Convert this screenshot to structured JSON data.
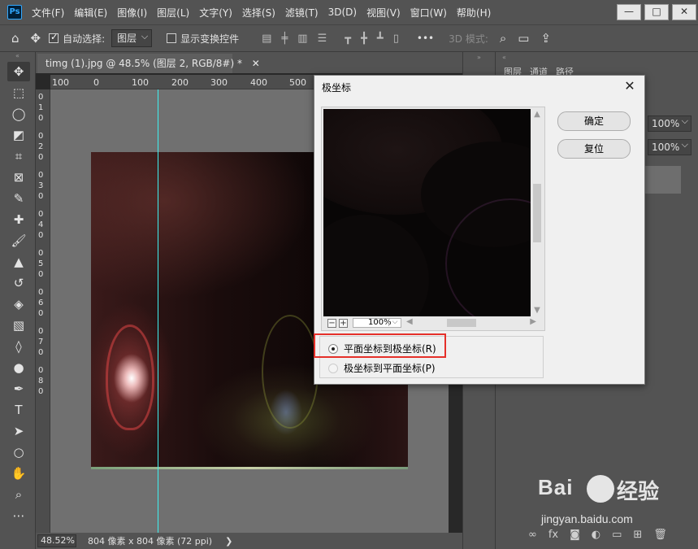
{
  "app": {
    "logo": "Ps",
    "menu": [
      "文件(F)",
      "编辑(E)",
      "图像(I)",
      "图层(L)",
      "文字(Y)",
      "选择(S)",
      "滤镜(T)",
      "3D(D)",
      "视图(V)",
      "窗口(W)",
      "帮助(H)"
    ],
    "window_controls": [
      "—",
      "□",
      "✕"
    ]
  },
  "options_bar": {
    "auto_select_label": "自动选择:",
    "auto_select_value": "图层",
    "show_transform_label": "显示变换控件",
    "more": "•••",
    "mode_3d": "3D 模式:"
  },
  "document": {
    "tab_title": "timg (1).jpg @ 48.5% (图层 2, RGB/8#) *",
    "tab_close": "✕",
    "ruler_top": [
      "100",
      "0",
      "100",
      "200",
      "300",
      "400",
      "500"
    ],
    "ruler_left": [
      "0",
      "1",
      "0",
      "0",
      "2",
      "0",
      "0",
      "3",
      "0",
      "0",
      "4",
      "0",
      "0",
      "5",
      "0",
      "0",
      "6",
      "0",
      "0",
      "7",
      "0",
      "0",
      "8",
      "0"
    ],
    "zoom": "48.52%",
    "size_info": "804 像素 x 804 像素 (72 ppi)",
    "status_arrow": "❯"
  },
  "panels": {
    "tabs": [
      "图层",
      "通道",
      "路径"
    ],
    "opacity": "100%",
    "fill": "100%"
  },
  "dialog": {
    "title": "极坐标",
    "close": "✕",
    "ok_label": "确定",
    "reset_label": "复位",
    "preview_zoom": "100%",
    "zoom_out": "−",
    "zoom_in": "+",
    "options": [
      {
        "label": "平面坐标到极坐标(R)",
        "selected": true
      },
      {
        "label": "极坐标到平面坐标(P)",
        "selected": false
      }
    ]
  },
  "watermark": {
    "brand": "Bai",
    "brand_tail": "经验",
    "url": "jingyan.baidu.com"
  },
  "colors": {
    "highlight": "#e5302a",
    "guide": "#3ff0f0"
  }
}
